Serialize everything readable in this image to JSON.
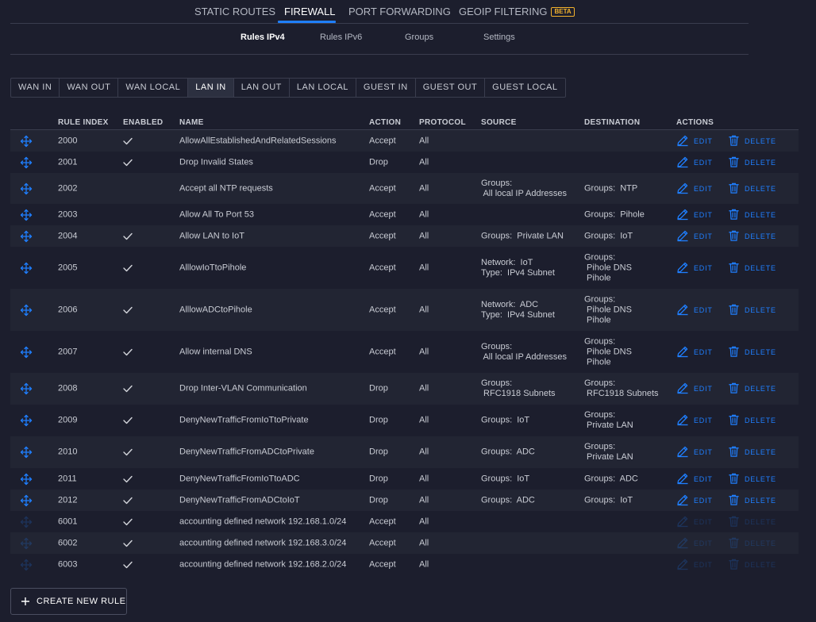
{
  "top_tabs": [
    {
      "label": "STATIC ROUTES"
    },
    {
      "label": "FIREWALL"
    },
    {
      "label": "PORT FORWARDING"
    },
    {
      "label": "GEOIP FILTERING"
    }
  ],
  "beta_badge": "BETA",
  "sub_tabs": [
    {
      "label": "Rules IPv4"
    },
    {
      "label": "Rules IPv6"
    },
    {
      "label": "Groups"
    },
    {
      "label": "Settings"
    }
  ],
  "chain_tabs": [
    {
      "label": "WAN IN"
    },
    {
      "label": "WAN OUT"
    },
    {
      "label": "WAN LOCAL"
    },
    {
      "label": "LAN IN"
    },
    {
      "label": "LAN OUT"
    },
    {
      "label": "LAN LOCAL"
    },
    {
      "label": "GUEST IN"
    },
    {
      "label": "GUEST OUT"
    },
    {
      "label": "GUEST LOCAL"
    }
  ],
  "active_chain": "LAN IN",
  "columns": {
    "rule_index": "RULE INDEX",
    "enabled": "ENABLED",
    "name": "NAME",
    "action": "ACTION",
    "protocol": "PROTOCOL",
    "source": "SOURCE",
    "destination": "DESTINATION",
    "actions": "ACTIONS"
  },
  "edit_label": "EDIT",
  "delete_label": "DELETE",
  "rules": [
    {
      "index": "2000",
      "enabled": true,
      "name": "AllowAllEstablishedAndRelatedSessions",
      "action": "Accept",
      "protocol": "All",
      "source": "",
      "destination": "",
      "disabled": false
    },
    {
      "index": "2001",
      "enabled": true,
      "name": "Drop Invalid States",
      "action": "Drop",
      "protocol": "All",
      "source": "",
      "destination": "",
      "disabled": false
    },
    {
      "index": "2002",
      "enabled": false,
      "name": "Accept all NTP requests",
      "action": "Accept",
      "protocol": "All",
      "source": "Groups:\n All local IP Addresses",
      "destination": "Groups:  NTP",
      "disabled": false
    },
    {
      "index": "2003",
      "enabled": false,
      "name": "Allow All To Port 53",
      "action": "Accept",
      "protocol": "All",
      "source": "",
      "destination": "Groups:  Pihole",
      "disabled": false
    },
    {
      "index": "2004",
      "enabled": true,
      "name": "Allow LAN to IoT",
      "action": "Accept",
      "protocol": "All",
      "source": "Groups:  Private LAN",
      "destination": "Groups:  IoT",
      "disabled": false
    },
    {
      "index": "2005",
      "enabled": true,
      "name": "AlllowIoTtoPihole",
      "action": "Accept",
      "protocol": "All",
      "source": "Network:  IoT\nType:  IPv4 Subnet",
      "destination": "Groups:\n Pihole DNS\n Pihole",
      "disabled": false
    },
    {
      "index": "2006",
      "enabled": true,
      "name": "AlllowADCtoPihole",
      "action": "Accept",
      "protocol": "All",
      "source": "Network:  ADC\nType:  IPv4 Subnet",
      "destination": "Groups:\n Pihole DNS\n Pihole",
      "disabled": false
    },
    {
      "index": "2007",
      "enabled": true,
      "name": "Allow internal DNS",
      "action": "Accept",
      "protocol": "All",
      "source": "Groups:\n All local IP Addresses",
      "destination": "Groups:\n Pihole DNS\n Pihole",
      "disabled": false
    },
    {
      "index": "2008",
      "enabled": true,
      "name": "Drop Inter-VLAN Communication",
      "action": "Drop",
      "protocol": "All",
      "source": "Groups:\n RFC1918 Subnets",
      "destination": "Groups:\n RFC1918 Subnets",
      "disabled": false
    },
    {
      "index": "2009",
      "enabled": true,
      "name": "DenyNewTrafficFromIoTtoPrivate",
      "action": "Drop",
      "protocol": "All",
      "source": "Groups:  IoT",
      "destination": "Groups:\n Private LAN",
      "disabled": false
    },
    {
      "index": "2010",
      "enabled": true,
      "name": "DenyNewTrafficFromADCtoPrivate",
      "action": "Drop",
      "protocol": "All",
      "source": "Groups:  ADC",
      "destination": "Groups:\n Private LAN",
      "disabled": false
    },
    {
      "index": "2011",
      "enabled": true,
      "name": "DenyNewTrafficFromIoTtoADC",
      "action": "Drop",
      "protocol": "All",
      "source": "Groups:  IoT",
      "destination": "Groups:  ADC",
      "disabled": false
    },
    {
      "index": "2012",
      "enabled": true,
      "name": "DenyNewTrafficFromADCtoIoT",
      "action": "Drop",
      "protocol": "All",
      "source": "Groups:  ADC",
      "destination": "Groups:  IoT",
      "disabled": false
    },
    {
      "index": "6001",
      "enabled": true,
      "name": "accounting defined network 192.168.1.0/24",
      "action": "Accept",
      "protocol": "All",
      "source": "",
      "destination": "",
      "disabled": true
    },
    {
      "index": "6002",
      "enabled": true,
      "name": "accounting defined network 192.168.3.0/24",
      "action": "Accept",
      "protocol": "All",
      "source": "",
      "destination": "",
      "disabled": true
    },
    {
      "index": "6003",
      "enabled": true,
      "name": "accounting defined network 192.168.2.0/24",
      "action": "Accept",
      "protocol": "All",
      "source": "",
      "destination": "",
      "disabled": true
    }
  ],
  "create_button_label": "CREATE NEW RULE",
  "colors": {
    "accent": "#1f7fff",
    "background": "#1c1e2d",
    "row_alt": "#222533",
    "beta": "#f3b22d"
  }
}
